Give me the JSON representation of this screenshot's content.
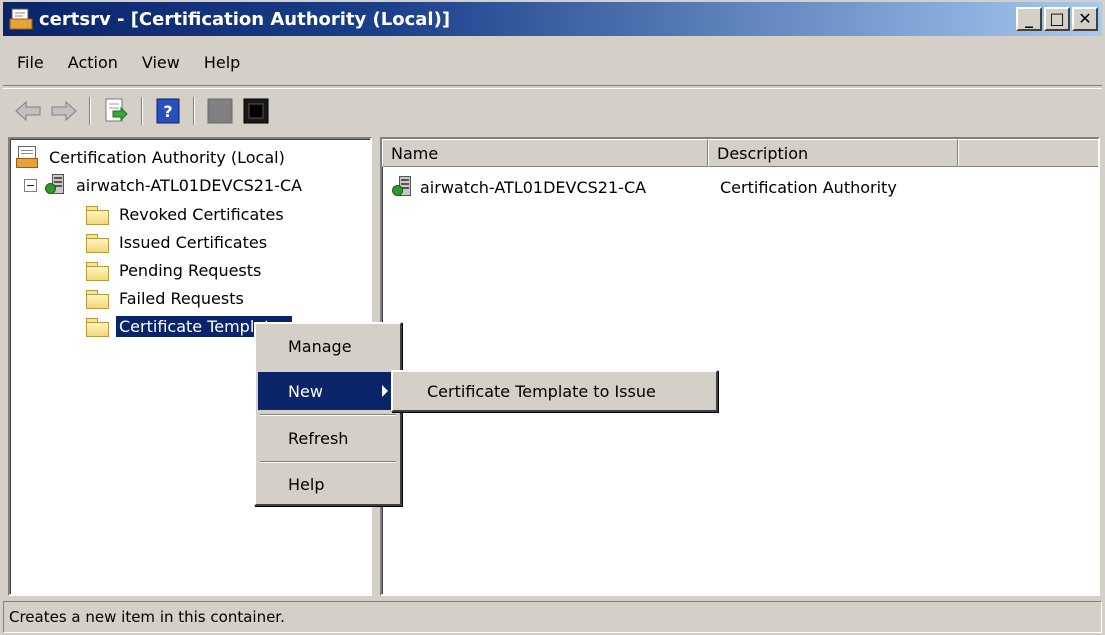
{
  "window": {
    "title": "certsrv - [Certification Authority (Local)]",
    "controls": {
      "minimize": "_",
      "maximize": "□",
      "close": "✕"
    }
  },
  "menubar": {
    "items": [
      {
        "label": "File"
      },
      {
        "label": "Action"
      },
      {
        "label": "View"
      },
      {
        "label": "Help"
      }
    ]
  },
  "toolbar": {
    "buttons": [
      {
        "icon": "back-arrow-icon"
      },
      {
        "icon": "forward-arrow-icon"
      },
      {
        "icon": "export-list-icon"
      },
      {
        "icon": "help-icon"
      },
      {
        "icon": "stop-service-icon"
      },
      {
        "icon": "start-service-icon"
      }
    ]
  },
  "tree": {
    "root": {
      "label": "Certification Authority (Local)",
      "icon": "certificate-authority-icon"
    },
    "ca": {
      "label": "airwatch-ATL01DEVCS21-CA",
      "expander": "−",
      "icon": "ca-server-icon"
    },
    "folders": [
      {
        "label": "Revoked Certificates"
      },
      {
        "label": "Issued Certificates"
      },
      {
        "label": "Pending Requests"
      },
      {
        "label": "Failed Requests"
      },
      {
        "label": "Certificate Templates",
        "selected": true
      }
    ]
  },
  "list": {
    "columns": [
      {
        "label": "Name"
      },
      {
        "label": "Description"
      },
      {
        "label": ""
      }
    ],
    "rows": [
      {
        "name": "airwatch-ATL01DEVCS21-CA",
        "description": "Certification Authority"
      }
    ]
  },
  "context_menu": {
    "items": [
      {
        "label": "Manage"
      },
      {
        "label": "New",
        "highlighted": true,
        "has_submenu": true
      },
      {
        "label": "Refresh"
      },
      {
        "label": "Help"
      }
    ]
  },
  "submenu": {
    "items": [
      {
        "label": "Certificate Template to Issue"
      }
    ]
  },
  "statusbar": {
    "text": "Creates a new item in this container."
  },
  "colors": {
    "selection": "#0a246a",
    "window_face": "#d4d0c8",
    "title_gradient_start": "#0a246a",
    "title_gradient_end": "#a6caf0"
  }
}
